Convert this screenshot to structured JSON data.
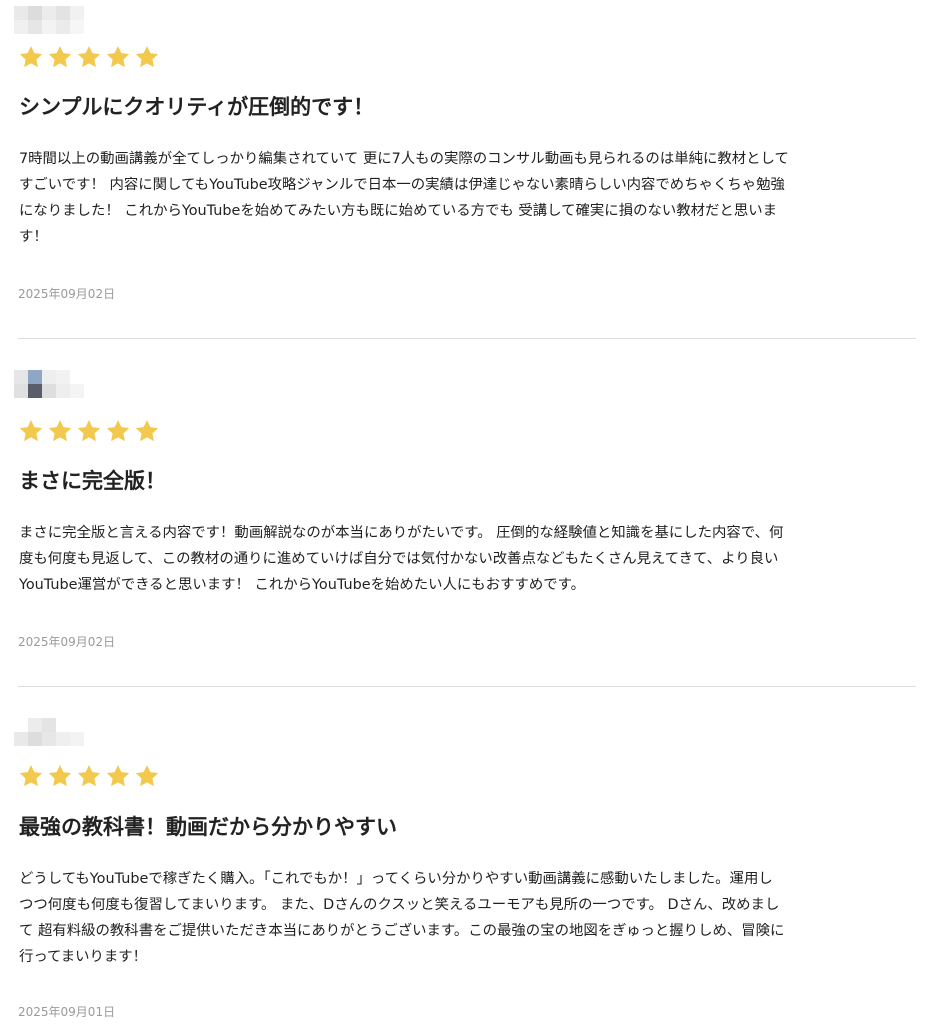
{
  "reviews": [
    {
      "rating": 5,
      "title": "シンプルにクオリティが圧倒的です！",
      "body": "7時間以上の動画講義が全てしっかり編集されていて 更に7人もの実際のコンサル動画も見られるのは単純に教材として\nすごいです！ 内容に関してもYouTube攻略ジャンルで日本一の実績は伊達じゃない素晴らしい内容でめちゃくちゃ勉強\nになりました！ これからYouTubeを始めてみたい方も既に始めている方でも 受講して確実に損のない教材だと思いま\nす！",
      "date": "2025年09月02日"
    },
    {
      "rating": 5,
      "title": "まさに完全版！",
      "body": "まさに完全版と言える内容です！動画解説なのが本当にありがたいです。 圧倒的な経験値と知識を基にした内容で、何\n度も何度も見返して、この教材の通りに進めていけば自分では気付かない改善点などもたくさん見えてきて、より良い\nYouTube運営ができると思います！ これからYouTubeを始めたい人にもおすすめです。",
      "date": "2025年09月02日"
    },
    {
      "rating": 5,
      "title": "最強の教科書！動画だから分かりやすい",
      "body": "どうしてもYouTubeで稼ぎたく購入。「これでもか！」ってくらい分かりやすい動画講義に感動いたしました。運用し\nつつ何度も何度も復習してまいります。 また、Dさんのクスッと笑えるユーモアも見所の一つです。 Dさん、改めまし\nて 超有料級の教科書をご提供いただき本当にありがとうございます。この最強の宝の地図をぎゅっと握りしめ、冒険に\n行ってまいります！",
      "date": "2025年09月01日"
    }
  ],
  "colors": {
    "star": "#F2C94C",
    "divider": "#dddddd",
    "date": "#9a9a9a",
    "text": "#222222"
  },
  "icons": {
    "star": "star-icon",
    "avatar": "avatar-icon"
  }
}
